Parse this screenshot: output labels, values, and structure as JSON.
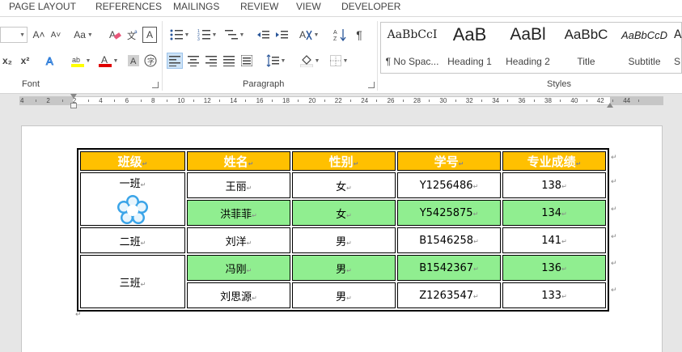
{
  "ribbon_tabs": [
    "PAGE LAYOUT",
    "REFERENCES",
    "MAILINGS",
    "REVIEW",
    "VIEW",
    "DEVELOPER"
  ],
  "groups": {
    "font": "Font",
    "paragraph": "Paragraph",
    "styles": "Styles"
  },
  "font_controls": {
    "grow_font": "A˄",
    "shrink_font": "A˅",
    "change_case": "Aa",
    "subscript": "x₂",
    "superscript": "x²"
  },
  "styles_gallery": [
    {
      "sample": "AaBbCcI",
      "name": "¶ No Spac..."
    },
    {
      "sample": "AaB",
      "name": "Heading 1"
    },
    {
      "sample": "AaBl",
      "name": "Heading 2"
    },
    {
      "sample": "AaBbC",
      "name": "Title"
    },
    {
      "sample": "AaBbCcD",
      "name": "Subtitle"
    },
    {
      "sample": "A",
      "name": "S"
    }
  ],
  "ruler_numbers": [
    "4",
    "2",
    "2",
    "4",
    "6",
    "8",
    "10",
    "12",
    "14",
    "16",
    "18",
    "20",
    "22",
    "24",
    "26",
    "28",
    "30",
    "32",
    "34",
    "36",
    "38",
    "40",
    "42",
    "44"
  ],
  "table": {
    "headers": [
      "班级",
      "姓名",
      "性别",
      "学号",
      "专业成绩"
    ],
    "classes": [
      "一班",
      "二班",
      "三班"
    ],
    "rows": [
      {
        "name": "王丽",
        "gender": "女",
        "id": "Y1256486",
        "score": "138"
      },
      {
        "name": "洪菲菲",
        "gender": "女",
        "id": "Y5425875",
        "score": "134"
      },
      {
        "name": "刘洋",
        "gender": "男",
        "id": "B1546258",
        "score": "141"
      },
      {
        "name": "冯刚",
        "gender": "男",
        "id": "B1542367",
        "score": "136"
      },
      {
        "name": "刘思源",
        "gender": "男",
        "id": "Z1263547",
        "score": "133"
      }
    ]
  },
  "colors": {
    "header_fill": "#ffc000",
    "highlight_row": "#90ee90",
    "accent": "#2b579a"
  }
}
